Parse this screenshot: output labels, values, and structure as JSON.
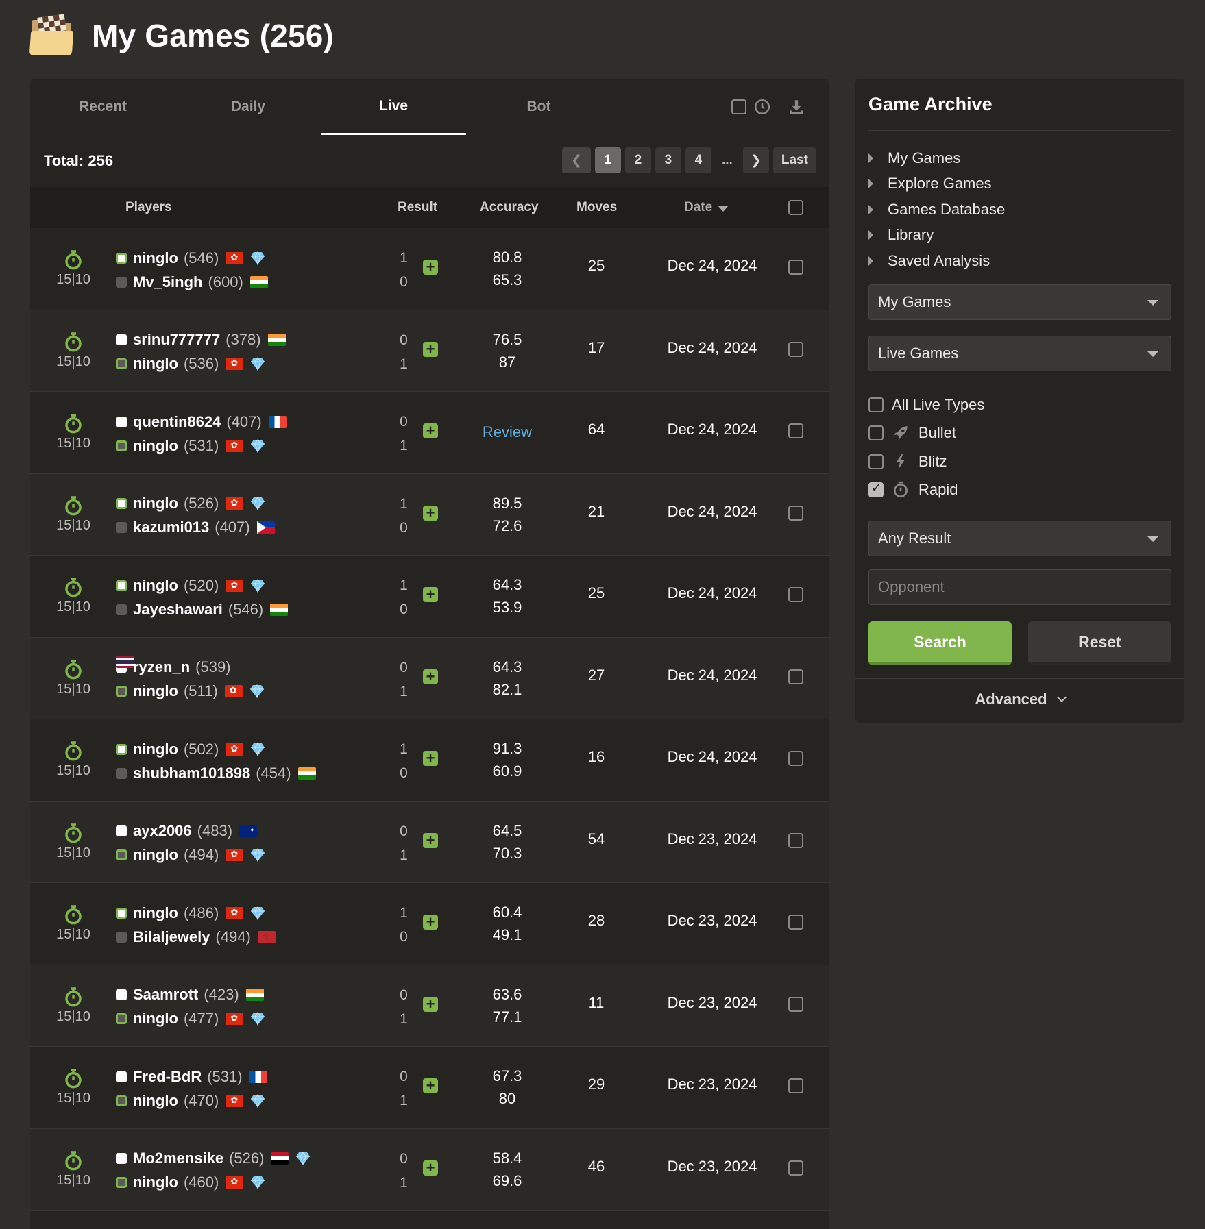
{
  "header": {
    "title": "My Games (256)",
    "icon": "folder-chess-icon"
  },
  "tabs": [
    {
      "label": "Recent",
      "active": false
    },
    {
      "label": "Daily",
      "active": false
    },
    {
      "label": "Live",
      "active": true
    },
    {
      "label": "Bot",
      "active": false
    }
  ],
  "toolbar": {
    "icons": [
      "select-all-checkbox",
      "clock-icon",
      "download-icon"
    ]
  },
  "total": {
    "label": "Total: 256"
  },
  "pagination": {
    "pages": [
      "1",
      "2",
      "3",
      "4"
    ],
    "dots": "...",
    "last": "Last",
    "current": "1"
  },
  "table": {
    "headers": {
      "players": "Players",
      "result": "Result",
      "accuracy": "Accuracy",
      "moves": "Moves",
      "date": "Date"
    },
    "rows": [
      {
        "tc": "15|10",
        "p1": {
          "name": "ninglo",
          "rating": "(546)",
          "flag": "hk",
          "gem": true,
          "win": true
        },
        "p2": {
          "name": "Mv_5ingh",
          "rating": "(600)",
          "flag": "in",
          "gem": false,
          "win": false
        },
        "r1": "1",
        "r2": "0",
        "a1": "80.8",
        "a2": "65.3",
        "moves": "25",
        "date": "Dec 24, 2024"
      },
      {
        "tc": "15|10",
        "p1": {
          "name": "srinu777777",
          "rating": "(378)",
          "flag": "in",
          "gem": false,
          "win": false
        },
        "p2": {
          "name": "ninglo",
          "rating": "(536)",
          "flag": "hk",
          "gem": true,
          "win": true
        },
        "r1": "0",
        "r2": "1",
        "a1": "76.5",
        "a2": "87",
        "moves": "17",
        "date": "Dec 24, 2024"
      },
      {
        "tc": "15|10",
        "p1": {
          "name": "quentin8624",
          "rating": "(407)",
          "flag": "fr",
          "gem": false,
          "win": false
        },
        "p2": {
          "name": "ninglo",
          "rating": "(531)",
          "flag": "hk",
          "gem": true,
          "win": true
        },
        "r1": "0",
        "r2": "1",
        "review": "Review",
        "moves": "64",
        "date": "Dec 24, 2024"
      },
      {
        "tc": "15|10",
        "p1": {
          "name": "ninglo",
          "rating": "(526)",
          "flag": "hk",
          "gem": true,
          "win": true
        },
        "p2": {
          "name": "kazumi013",
          "rating": "(407)",
          "flag": "ph",
          "gem": false,
          "win": false
        },
        "r1": "1",
        "r2": "0",
        "a1": "89.5",
        "a2": "72.6",
        "moves": "21",
        "date": "Dec 24, 2024"
      },
      {
        "tc": "15|10",
        "p1": {
          "name": "ninglo",
          "rating": "(520)",
          "flag": "hk",
          "gem": true,
          "win": true
        },
        "p2": {
          "name": "Jayeshawari",
          "rating": "(546)",
          "flag": "in",
          "gem": false,
          "win": false
        },
        "r1": "1",
        "r2": "0",
        "a1": "64.3",
        "a2": "53.9",
        "moves": "25",
        "date": "Dec 24, 2024"
      },
      {
        "tc": "15|10",
        "p1": {
          "name": "ryzen_n",
          "rating": "(539)",
          "flag": "th",
          "gem": false,
          "win": false
        },
        "p2": {
          "name": "ninglo",
          "rating": "(511)",
          "flag": "hk",
          "gem": true,
          "win": true
        },
        "r1": "0",
        "r2": "1",
        "a1": "64.3",
        "a2": "82.1",
        "moves": "27",
        "date": "Dec 24, 2024"
      },
      {
        "tc": "15|10",
        "p1": {
          "name": "ninglo",
          "rating": "(502)",
          "flag": "hk",
          "gem": true,
          "win": true
        },
        "p2": {
          "name": "shubham101898",
          "rating": "(454)",
          "flag": "in",
          "gem": false,
          "win": false
        },
        "r1": "1",
        "r2": "0",
        "a1": "91.3",
        "a2": "60.9",
        "moves": "16",
        "date": "Dec 24, 2024"
      },
      {
        "tc": "15|10",
        "p1": {
          "name": "ayx2006",
          "rating": "(483)",
          "flag": "au",
          "gem": false,
          "win": false
        },
        "p2": {
          "name": "ninglo",
          "rating": "(494)",
          "flag": "hk",
          "gem": true,
          "win": true
        },
        "r1": "0",
        "r2": "1",
        "a1": "64.5",
        "a2": "70.3",
        "moves": "54",
        "date": "Dec 23, 2024"
      },
      {
        "tc": "15|10",
        "p1": {
          "name": "ninglo",
          "rating": "(486)",
          "flag": "hk",
          "gem": true,
          "win": true
        },
        "p2": {
          "name": "Bilaljewely",
          "rating": "(494)",
          "flag": "ma",
          "gem": false,
          "win": false
        },
        "r1": "1",
        "r2": "0",
        "a1": "60.4",
        "a2": "49.1",
        "moves": "28",
        "date": "Dec 23, 2024"
      },
      {
        "tc": "15|10",
        "p1": {
          "name": "Saamrott",
          "rating": "(423)",
          "flag": "in",
          "gem": false,
          "win": false
        },
        "p2": {
          "name": "ninglo",
          "rating": "(477)",
          "flag": "hk",
          "gem": true,
          "win": true
        },
        "r1": "0",
        "r2": "1",
        "a1": "63.6",
        "a2": "77.1",
        "moves": "11",
        "date": "Dec 23, 2024"
      },
      {
        "tc": "15|10",
        "p1": {
          "name": "Fred-BdR",
          "rating": "(531)",
          "flag": "fr",
          "gem": false,
          "win": false
        },
        "p2": {
          "name": "ninglo",
          "rating": "(470)",
          "flag": "hk",
          "gem": true,
          "win": true
        },
        "r1": "0",
        "r2": "1",
        "a1": "67.3",
        "a2": "80",
        "moves": "29",
        "date": "Dec 23, 2024"
      },
      {
        "tc": "15|10",
        "p1": {
          "name": "Mo2mensike",
          "rating": "(526)",
          "flag": "eg",
          "gem": true,
          "win": false
        },
        "p2": {
          "name": "ninglo",
          "rating": "(460)",
          "flag": "hk",
          "gem": true,
          "win": true
        },
        "r1": "0",
        "r2": "1",
        "a1": "58.4",
        "a2": "69.6",
        "moves": "46",
        "date": "Dec 23, 2024"
      }
    ]
  },
  "sidebar": {
    "title": "Game Archive",
    "links": [
      "My Games",
      "Explore Games",
      "Games Database",
      "Library",
      "Saved Analysis"
    ],
    "select1": "My Games",
    "select2": "Live Games",
    "checks": [
      {
        "label": "All Live Types",
        "checked": false,
        "icon": ""
      },
      {
        "label": "Bullet",
        "checked": false,
        "icon": "bullet-icon"
      },
      {
        "label": "Blitz",
        "checked": false,
        "icon": "blitz-icon"
      },
      {
        "label": "Rapid",
        "checked": true,
        "icon": "rapid-icon"
      }
    ],
    "select3": "Any Result",
    "opponent_placeholder": "Opponent",
    "search": "Search",
    "reset": "Reset",
    "advanced": "Advanced"
  },
  "colors": {
    "accent_green": "#81b64c",
    "link_blue": "#5dade2",
    "bg": "#302e2b",
    "panel": "#262421"
  }
}
